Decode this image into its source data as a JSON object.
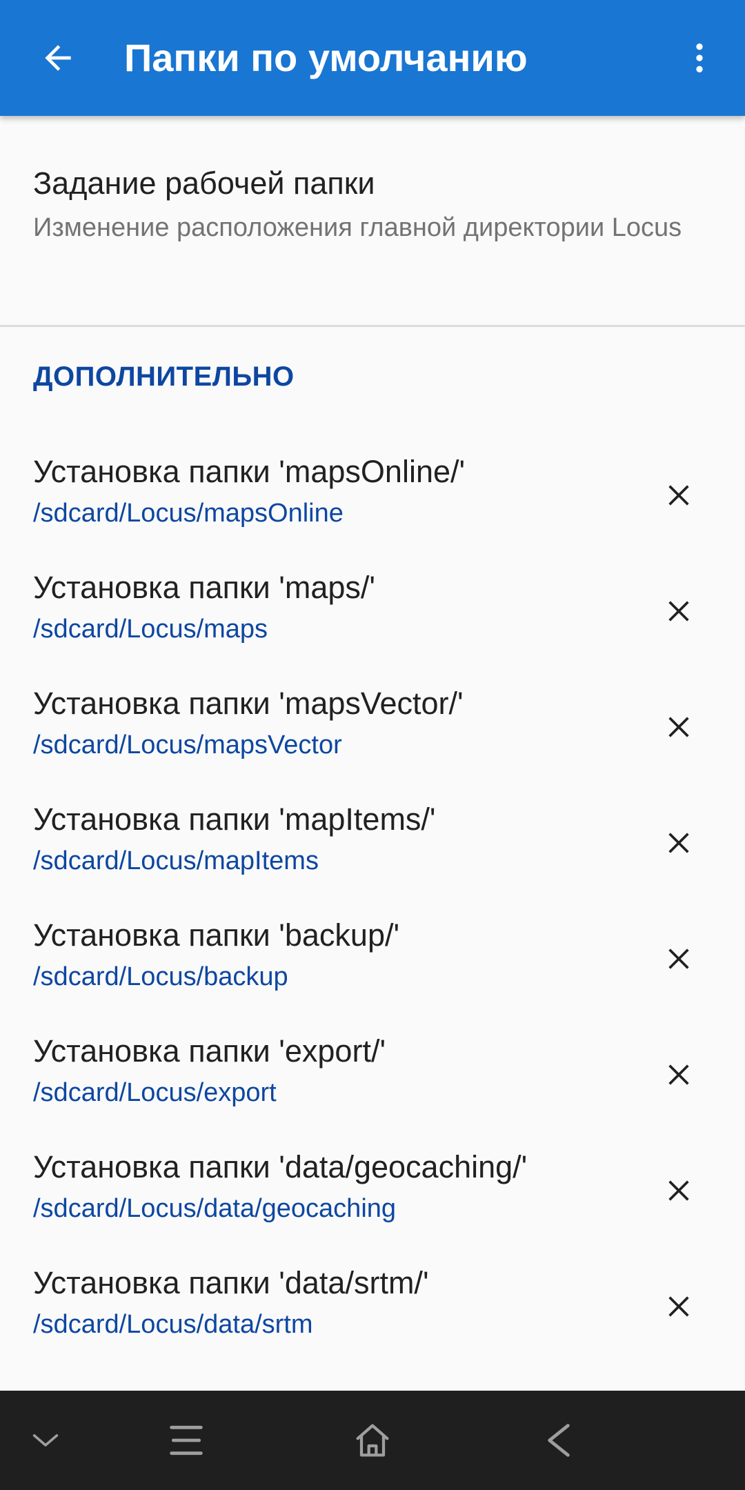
{
  "appbar": {
    "title": "Папки по умолчанию",
    "back_icon": "arrow-back-icon",
    "more_icon": "more-vert-icon",
    "color": "#1976d2"
  },
  "working_folder": {
    "title": "Задание рабочей папки",
    "summary": "Изменение расположения главной директории Locus"
  },
  "section": {
    "header": "ДОПОЛНИТЕЛЬНО",
    "accent_color": "#0d47a1"
  },
  "folders": [
    {
      "title": "Установка папки 'mapsOnline/'",
      "path": "/sdcard/Locus/mapsOnline"
    },
    {
      "title": "Установка папки 'maps/'",
      "path": "/sdcard/Locus/maps"
    },
    {
      "title": "Установка папки 'mapsVector/'",
      "path": "/sdcard/Locus/mapsVector"
    },
    {
      "title": "Установка папки 'mapItems/'",
      "path": "/sdcard/Locus/mapItems"
    },
    {
      "title": "Установка папки 'backup/'",
      "path": "/sdcard/Locus/backup"
    },
    {
      "title": "Установка папки 'export/'",
      "path": "/sdcard/Locus/export"
    },
    {
      "title": "Установка папки 'data/geocaching/'",
      "path": "/sdcard/Locus/data/geocaching"
    },
    {
      "title": "Установка папки 'data/srtm/'",
      "path": "/sdcard/Locus/data/srtm"
    }
  ],
  "clear_icon": "close-icon",
  "navbar": {
    "icons": [
      "chevron-down-icon",
      "menu-icon",
      "home-icon",
      "back-icon"
    ]
  }
}
